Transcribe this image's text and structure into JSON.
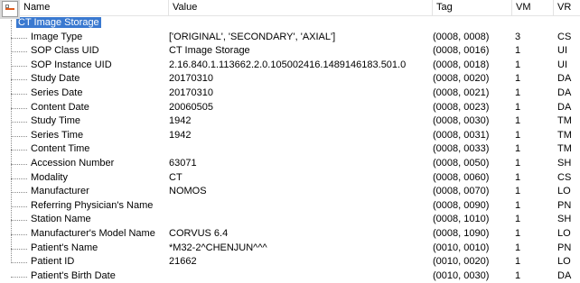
{
  "columns": {
    "name": "Name",
    "value": "Value",
    "tag": "Tag",
    "vm": "VM",
    "vr": "VR"
  },
  "root": {
    "label": "CT Image Storage"
  },
  "rows": [
    {
      "name": "Image Type",
      "value": "['ORIGINAL', 'SECONDARY', 'AXIAL']",
      "tag": "(0008, 0008)",
      "vm": "3",
      "vr": "CS"
    },
    {
      "name": "SOP Class UID",
      "value": "CT Image Storage",
      "tag": "(0008, 0016)",
      "vm": "1",
      "vr": "UI"
    },
    {
      "name": "SOP Instance UID",
      "value": "2.16.840.1.113662.2.0.105002416.1489146183.501.0",
      "tag": "(0008, 0018)",
      "vm": "1",
      "vr": "UI"
    },
    {
      "name": "Study Date",
      "value": "20170310",
      "tag": "(0008, 0020)",
      "vm": "1",
      "vr": "DA"
    },
    {
      "name": "Series Date",
      "value": "20170310",
      "tag": "(0008, 0021)",
      "vm": "1",
      "vr": "DA"
    },
    {
      "name": "Content Date",
      "value": "20060505",
      "tag": "(0008, 0023)",
      "vm": "1",
      "vr": "DA"
    },
    {
      "name": "Study Time",
      "value": "1942",
      "tag": "(0008, 0030)",
      "vm": "1",
      "vr": "TM"
    },
    {
      "name": "Series Time",
      "value": "1942",
      "tag": "(0008, 0031)",
      "vm": "1",
      "vr": "TM"
    },
    {
      "name": "Content Time",
      "value": "",
      "tag": "(0008, 0033)",
      "vm": "1",
      "vr": "TM"
    },
    {
      "name": "Accession Number",
      "value": "63071",
      "tag": "(0008, 0050)",
      "vm": "1",
      "vr": "SH"
    },
    {
      "name": "Modality",
      "value": "CT",
      "tag": "(0008, 0060)",
      "vm": "1",
      "vr": "CS"
    },
    {
      "name": "Manufacturer",
      "value": "NOMOS",
      "tag": "(0008, 0070)",
      "vm": "1",
      "vr": "LO"
    },
    {
      "name": "Referring Physician's Name",
      "value": "",
      "tag": "(0008, 0090)",
      "vm": "1",
      "vr": "PN"
    },
    {
      "name": "Station Name",
      "value": "",
      "tag": "(0008, 1010)",
      "vm": "1",
      "vr": "SH"
    },
    {
      "name": "Manufacturer's Model Name",
      "value": "CORVUS 6.4",
      "tag": "(0008, 1090)",
      "vm": "1",
      "vr": "LO"
    },
    {
      "name": "Patient's Name",
      "value": "*M32-2^CHENJUN^^^",
      "tag": "(0010, 0010)",
      "vm": "1",
      "vr": "PN"
    },
    {
      "name": "Patient ID",
      "value": "21662",
      "tag": "(0010, 0020)",
      "vm": "1",
      "vr": "LO"
    },
    {
      "name": "Patient's Birth Date",
      "value": "",
      "tag": "(0010, 0030)",
      "vm": "1",
      "vr": "DA"
    }
  ]
}
